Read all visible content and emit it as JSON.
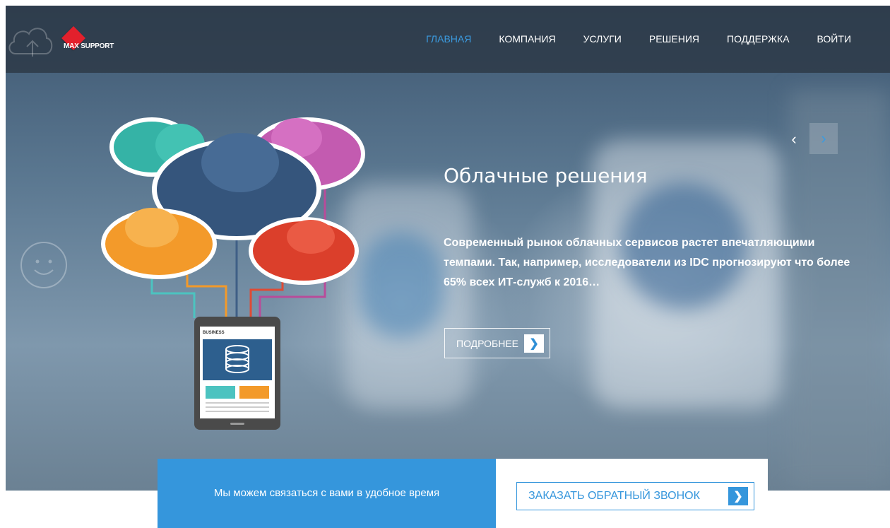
{
  "brand": {
    "logo_text": "MAX SUPPORT"
  },
  "nav": {
    "items": [
      {
        "label": "ГЛАВНАЯ",
        "active": true
      },
      {
        "label": "КОМПАНИЯ",
        "active": false
      },
      {
        "label": "УСЛУГИ",
        "active": false
      },
      {
        "label": "РЕШЕНИЯ",
        "active": false
      },
      {
        "label": "ПОДДЕРЖКА",
        "active": false
      },
      {
        "label": "ВОЙТИ",
        "active": false
      }
    ]
  },
  "slider": {
    "prev_icon": "chevron-left-icon",
    "next_icon": "chevron-right-icon",
    "title": "Облачные решения",
    "text": "Современный рынок облачных сервисов растет впечатляющими темпами. Так, например, исследователи из IDC прогнозируют что более 65% всех ИТ-служб к 2016…",
    "more_label": "ПОДРОБНЕЕ",
    "illustration_label": "BUSINESS"
  },
  "callback": {
    "text": "Мы можем связаться с вами в удобное время",
    "button_label": "ЗАКАЗАТЬ ОБРАТНЫЙ ЗВОНОК"
  },
  "colors": {
    "accent": "#3596dc",
    "active_nav": "#3b9be0",
    "logo_red": "#e3202c"
  }
}
